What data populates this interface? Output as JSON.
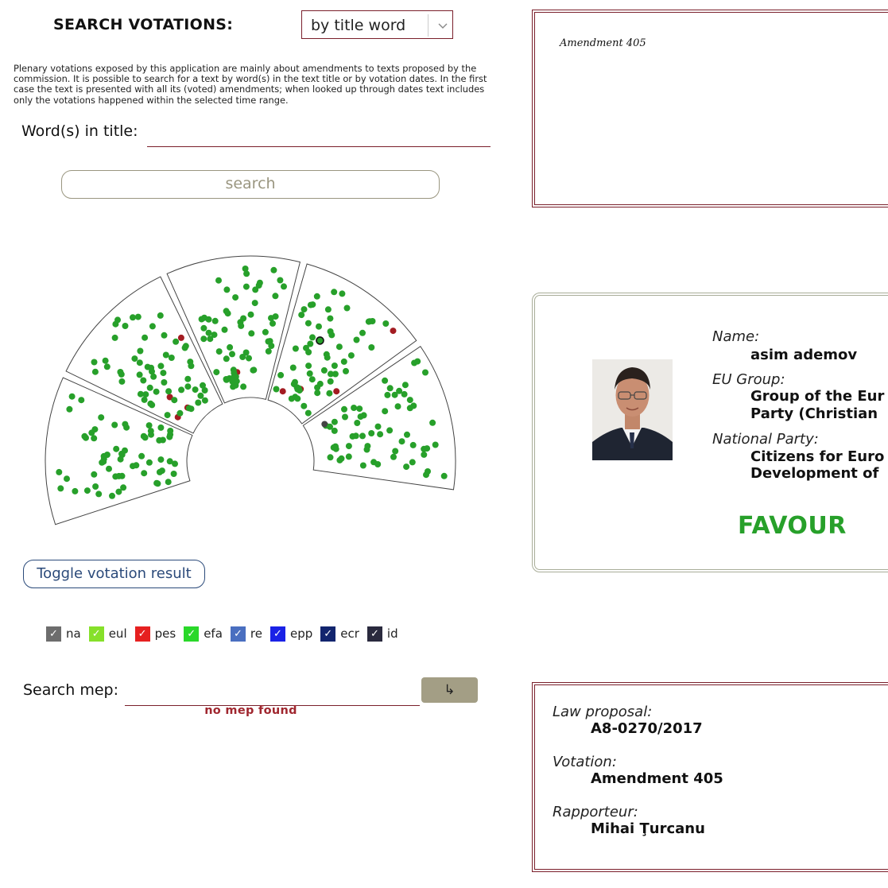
{
  "search": {
    "heading": "SEARCH VOTATIONS:",
    "mode": "by title word",
    "intro": "Plenary votations exposed by this application are mainly about amendments to texts proposed by the commission. It is possible to search for a text by word(s) in the text title or by votation dates. In the first case the text is presented with all its (voted) amendments; when looked up through dates text includes only the votations happened within the selected time range.",
    "title_label": "Word(s) in title:",
    "title_value": "",
    "search_button": "search"
  },
  "hemicycle": {
    "toggle_button": "Toggle votation result",
    "colors": {
      "favour": "#27a02a",
      "against": "#a31c22",
      "abstention": "#444444"
    }
  },
  "legend": [
    {
      "label": "na",
      "color": "#6d6d6d",
      "checked": true
    },
    {
      "label": "eul",
      "color": "#86e02a",
      "checked": true
    },
    {
      "label": "pes",
      "color": "#e62020",
      "checked": true
    },
    {
      "label": "efa",
      "color": "#2ad82a",
      "checked": true
    },
    {
      "label": "re",
      "color": "#4a6fc0",
      "checked": true
    },
    {
      "label": "epp",
      "color": "#1a22e6",
      "checked": true
    },
    {
      "label": "ecr",
      "color": "#12256e",
      "checked": true
    },
    {
      "label": "id",
      "color": "#2a2a3e",
      "checked": true
    }
  ],
  "mep_search": {
    "label": "Search mep:",
    "value": "",
    "go_symbol": "↳",
    "message": "no mep found"
  },
  "amendment_panel": {
    "text": "Amendment 405"
  },
  "mep_card": {
    "name_label": "Name:",
    "name": "asim ademov",
    "group_label": "EU Group:",
    "group_line1": "Group of the Eur",
    "group_line2": "Party (Christian",
    "party_label": "National Party:",
    "party_line1": "Citizens for Euro",
    "party_line2": "Development of",
    "vote": "FAVOUR"
  },
  "info": {
    "law_label": "Law proposal:",
    "law_value": "A8-0270/2017",
    "votation_label": "Votation:",
    "votation_value": "Amendment 405",
    "rapporteur_label": "Rapporteur:",
    "rapporteur_value": "Mihai Ţurcanu"
  }
}
